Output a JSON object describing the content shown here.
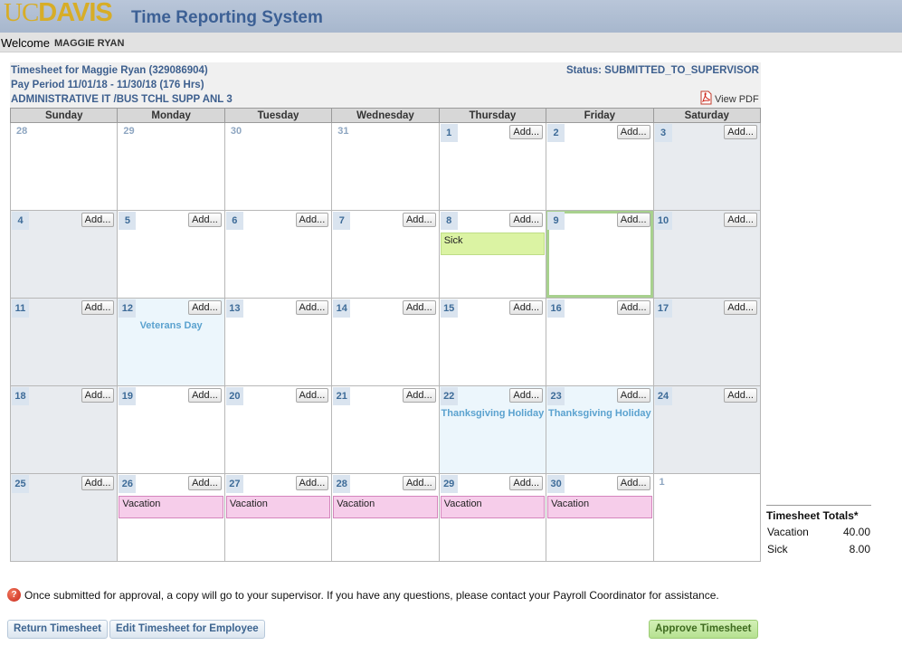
{
  "header": {
    "logo_uc": "UC",
    "logo_davis": "DAVIS",
    "app_title": "Time Reporting System"
  },
  "welcome": {
    "label": "Welcome",
    "name": "MAGGIE RYAN"
  },
  "timesheet": {
    "owner_line": "Timesheet for Maggie Ryan (329086904)",
    "pay_period": "Pay Period 11/01/18 - 11/30/18 (176 Hrs)",
    "position": "ADMINISTRATIVE IT /BUS TCHL SUPP ANL 3",
    "status": "Status: SUBMITTED_TO_SUPERVISOR",
    "view_pdf": "View PDF"
  },
  "calendar": {
    "days": [
      "Sunday",
      "Monday",
      "Tuesday",
      "Wednesday",
      "Thursday",
      "Friday",
      "Saturday"
    ],
    "add_label": "Add...",
    "weeks": [
      [
        {
          "day": "28",
          "outside": true
        },
        {
          "day": "29",
          "outside": true
        },
        {
          "day": "30",
          "outside": true
        },
        {
          "day": "31",
          "outside": true
        },
        {
          "day": "1"
        },
        {
          "day": "2"
        },
        {
          "day": "3",
          "weekend": true
        }
      ],
      [
        {
          "day": "4",
          "weekend": true
        },
        {
          "day": "5"
        },
        {
          "day": "6"
        },
        {
          "day": "7"
        },
        {
          "day": "8",
          "entry": {
            "type": "sick",
            "label": "Sick"
          }
        },
        {
          "day": "9",
          "selected": true
        },
        {
          "day": "10",
          "weekend": true
        }
      ],
      [
        {
          "day": "11",
          "weekend": true
        },
        {
          "day": "12",
          "holiday": "Veterans Day"
        },
        {
          "day": "13"
        },
        {
          "day": "14"
        },
        {
          "day": "15"
        },
        {
          "day": "16"
        },
        {
          "day": "17",
          "weekend": true
        }
      ],
      [
        {
          "day": "18",
          "weekend": true
        },
        {
          "day": "19"
        },
        {
          "day": "20"
        },
        {
          "day": "21"
        },
        {
          "day": "22",
          "holiday": "Thanksgiving Holiday"
        },
        {
          "day": "23",
          "holiday": "Thanksgiving Holiday"
        },
        {
          "day": "24",
          "weekend": true
        }
      ],
      [
        {
          "day": "25",
          "weekend": true
        },
        {
          "day": "26",
          "entry": {
            "type": "vacation",
            "label": "Vacation"
          }
        },
        {
          "day": "27",
          "entry": {
            "type": "vacation",
            "label": "Vacation"
          }
        },
        {
          "day": "28",
          "entry": {
            "type": "vacation",
            "label": "Vacation"
          }
        },
        {
          "day": "29",
          "entry": {
            "type": "vacation",
            "label": "Vacation"
          }
        },
        {
          "day": "30",
          "entry": {
            "type": "vacation",
            "label": "Vacation"
          }
        },
        {
          "day": "1",
          "outside": true
        }
      ]
    ]
  },
  "totals": {
    "title": "Timesheet Totals*",
    "rows": [
      {
        "label": "Vacation",
        "value": "40.00"
      },
      {
        "label": "Sick",
        "value": "8.00"
      }
    ]
  },
  "notice": "Once submitted for approval, a copy will go to your supervisor. If you have any questions, please contact your Payroll Coordinator for assistance.",
  "actions": {
    "return": "Return Timesheet",
    "edit": "Edit Timesheet for Employee",
    "approve": "Approve Timesheet"
  },
  "icons": {
    "pdf": "pdf-icon",
    "notice": "help-icon"
  },
  "colors": {
    "brand_gold": "#d7ad27",
    "title_blue": "#3c6095",
    "sick": "#dbf3a3",
    "vacation": "#f6cdea",
    "holiday_text": "#5ba2cf"
  }
}
